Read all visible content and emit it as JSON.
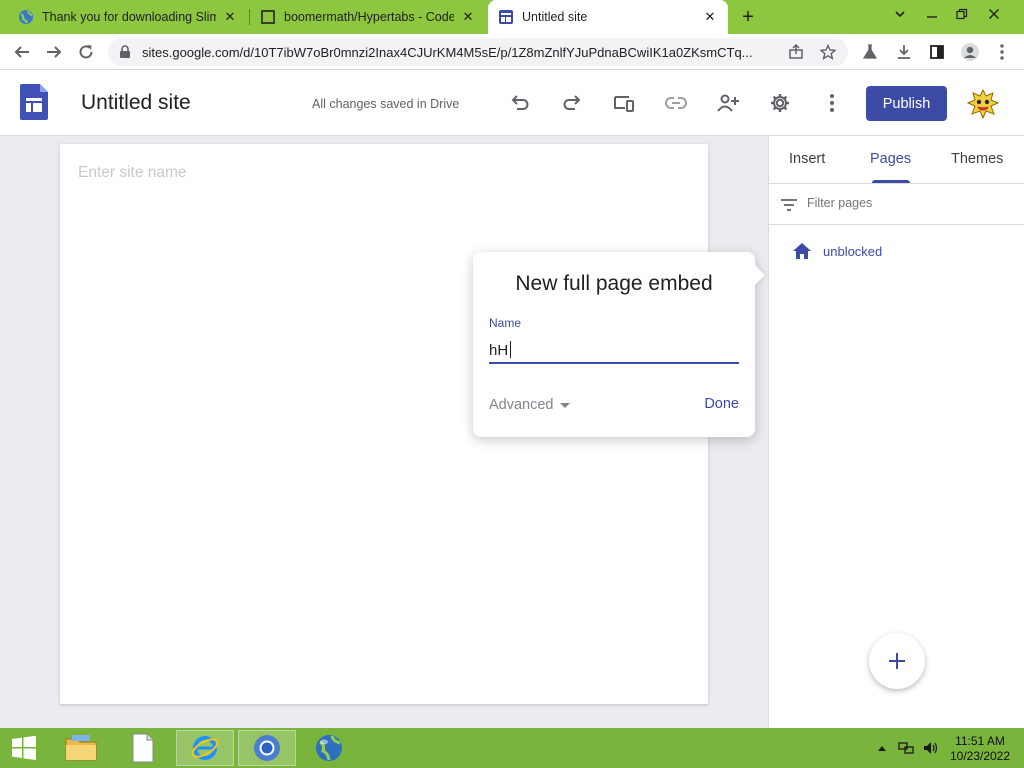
{
  "browser": {
    "tabs": [
      {
        "title": "Thank you for downloading Slim",
        "icon": "globe-icon",
        "active": false
      },
      {
        "title": "boomermath/Hypertabs - CodeS",
        "icon": "code-icon",
        "active": false
      },
      {
        "title": "Untitled site",
        "icon": "sites-icon",
        "active": true
      }
    ],
    "new_tab": "+",
    "url": "sites.google.com/d/10T7ibW7oBr0mnzi2Inax4CJUrKM4M5sE/p/1Z8mZnlfYJuPdnaBCwiIK1a0ZKsmCTq..."
  },
  "sites": {
    "site_title": "Untitled site",
    "save_status": "All changes saved in Drive",
    "publish_label": "Publish",
    "site_name_placeholder": "Enter site name"
  },
  "panel": {
    "tabs": [
      "Insert",
      "Pages",
      "Themes"
    ],
    "active_tab": "Pages",
    "filter_placeholder": "Filter pages",
    "pages": [
      {
        "label": "unblocked",
        "icon": "home-icon"
      }
    ],
    "fab_label": "+"
  },
  "dialog": {
    "title": "New full page embed",
    "name_label": "Name",
    "name_value": "hH",
    "advanced_label": "Advanced",
    "done_label": "Done"
  },
  "taskbar": {
    "time": "11:51 AM",
    "date": "10/23/2022"
  },
  "colors": {
    "accent": "#3c4ba6",
    "browser_frame": "#8dc63f",
    "taskbar": "#79b43c"
  }
}
